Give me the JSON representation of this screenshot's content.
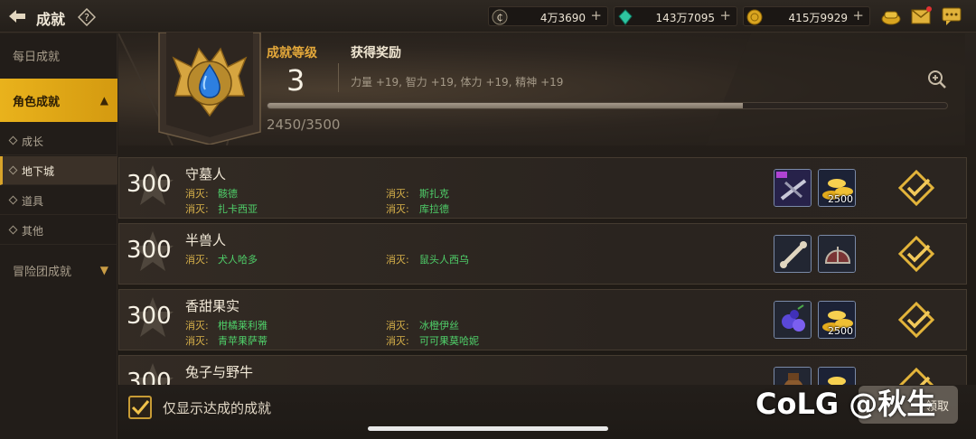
{
  "header": {
    "title": "成就",
    "back_icon": "back-arrow-icon",
    "help_icon": "question-icon",
    "currencies": [
      {
        "icon": "coin-c-icon",
        "value": "4万3690",
        "plus": "+"
      },
      {
        "icon": "gem-icon",
        "value": "143万7095",
        "plus": "+"
      },
      {
        "icon": "gold-icon",
        "value": "415万9929",
        "plus": "+"
      }
    ],
    "right_icons": [
      "chest-icon",
      "mail-icon",
      "chat-icon"
    ]
  },
  "sidebar": {
    "daily": "每日成就",
    "character": "角色成就",
    "subs": [
      "成长",
      "地下城",
      "道具",
      "其他"
    ],
    "adventure": "冒险团成就"
  },
  "summary": {
    "level_label": "成就等级",
    "level_value": "3",
    "reward_label": "获得奖励",
    "reward_value": "力量 +19, 智力 +19, 体力 +19, 精神 +19",
    "progress_text": "2450/3500",
    "progress_fraction": 0.7
  },
  "kill_prefix": "消灭:",
  "rows": [
    {
      "points": "300",
      "name": "守墓人",
      "targets": [
        "骸德",
        "斯扎克",
        "扎卡西亚",
        "库拉德"
      ],
      "rewards": [
        {
          "icon": "weapon-icon",
          "count": ""
        },
        {
          "icon": "gold-stack-icon",
          "count": "2500"
        }
      ]
    },
    {
      "points": "300",
      "name": "半兽人",
      "targets": [
        "犬人哈多",
        "鼠头人西乌"
      ],
      "rewards": [
        {
          "icon": "bone-icon",
          "count": ""
        },
        {
          "icon": "helmet-icon",
          "count": ""
        }
      ]
    },
    {
      "points": "300",
      "name": "香甜果实",
      "targets": [
        "柑橘莱利雅",
        "冰橙伊丝",
        "青苹果萨蒂",
        "可可果莫哈妮"
      ],
      "rewards": [
        {
          "icon": "berry-icon",
          "count": ""
        },
        {
          "icon": "gold-stack-icon",
          "count": "2500"
        }
      ]
    },
    {
      "points": "300",
      "name": "兔子与野牛",
      "targets": [],
      "rewards": [
        {
          "icon": "bag-icon",
          "count": ""
        },
        {
          "icon": "gold-stack-icon",
          "count": ""
        }
      ]
    }
  ],
  "footer": {
    "filter_label": "仅显示达成的成就",
    "claim_partial": "领取"
  },
  "watermark": "CoLG @秋生"
}
